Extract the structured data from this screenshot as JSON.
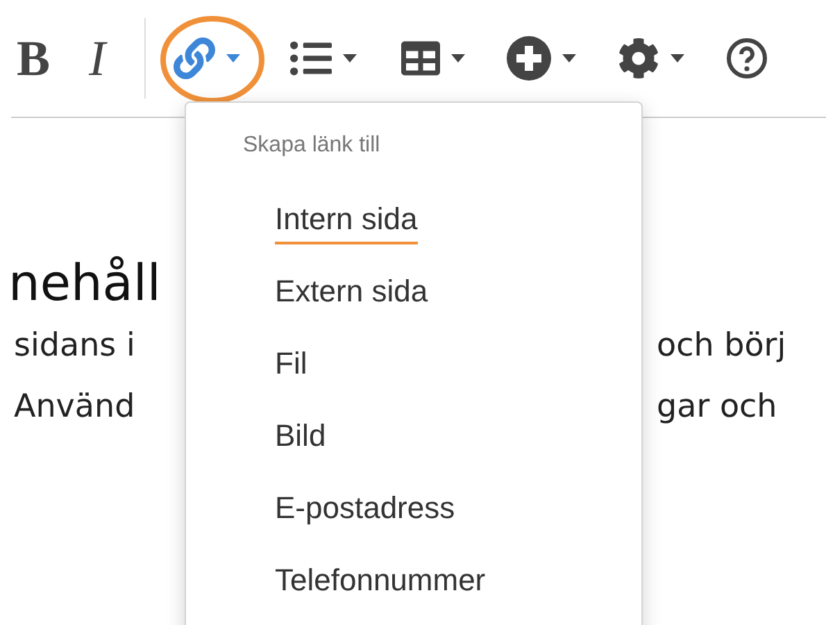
{
  "toolbar": {
    "items": [
      {
        "kind": "bold",
        "label": "B"
      },
      {
        "kind": "italic",
        "label": "I"
      },
      {
        "kind": "separator"
      },
      {
        "kind": "link",
        "dropdown": true,
        "highlighted": true
      },
      {
        "kind": "list",
        "dropdown": true,
        "highlighted": false
      },
      {
        "kind": "table",
        "dropdown": true,
        "highlighted": false
      },
      {
        "kind": "insert",
        "dropdown": true,
        "highlighted": false
      },
      {
        "kind": "settings",
        "dropdown": true,
        "highlighted": false
      },
      {
        "kind": "help",
        "dropdown": false,
        "highlighted": false
      }
    ]
  },
  "content": {
    "heading": "nehåll",
    "lines": [
      {
        "left": "sidans i",
        "right": "och börj"
      },
      {
        "left": "Använd",
        "right": "gar och"
      }
    ]
  },
  "link_menu": {
    "header": "Skapa länk till",
    "items": [
      {
        "label": "Intern sida",
        "selected": true
      },
      {
        "label": "Extern sida",
        "selected": false
      },
      {
        "label": "Fil",
        "selected": false
      },
      {
        "label": "Bild",
        "selected": false
      },
      {
        "label": "E-postadress",
        "selected": false
      },
      {
        "label": "Telefonnummer",
        "selected": false
      }
    ]
  }
}
